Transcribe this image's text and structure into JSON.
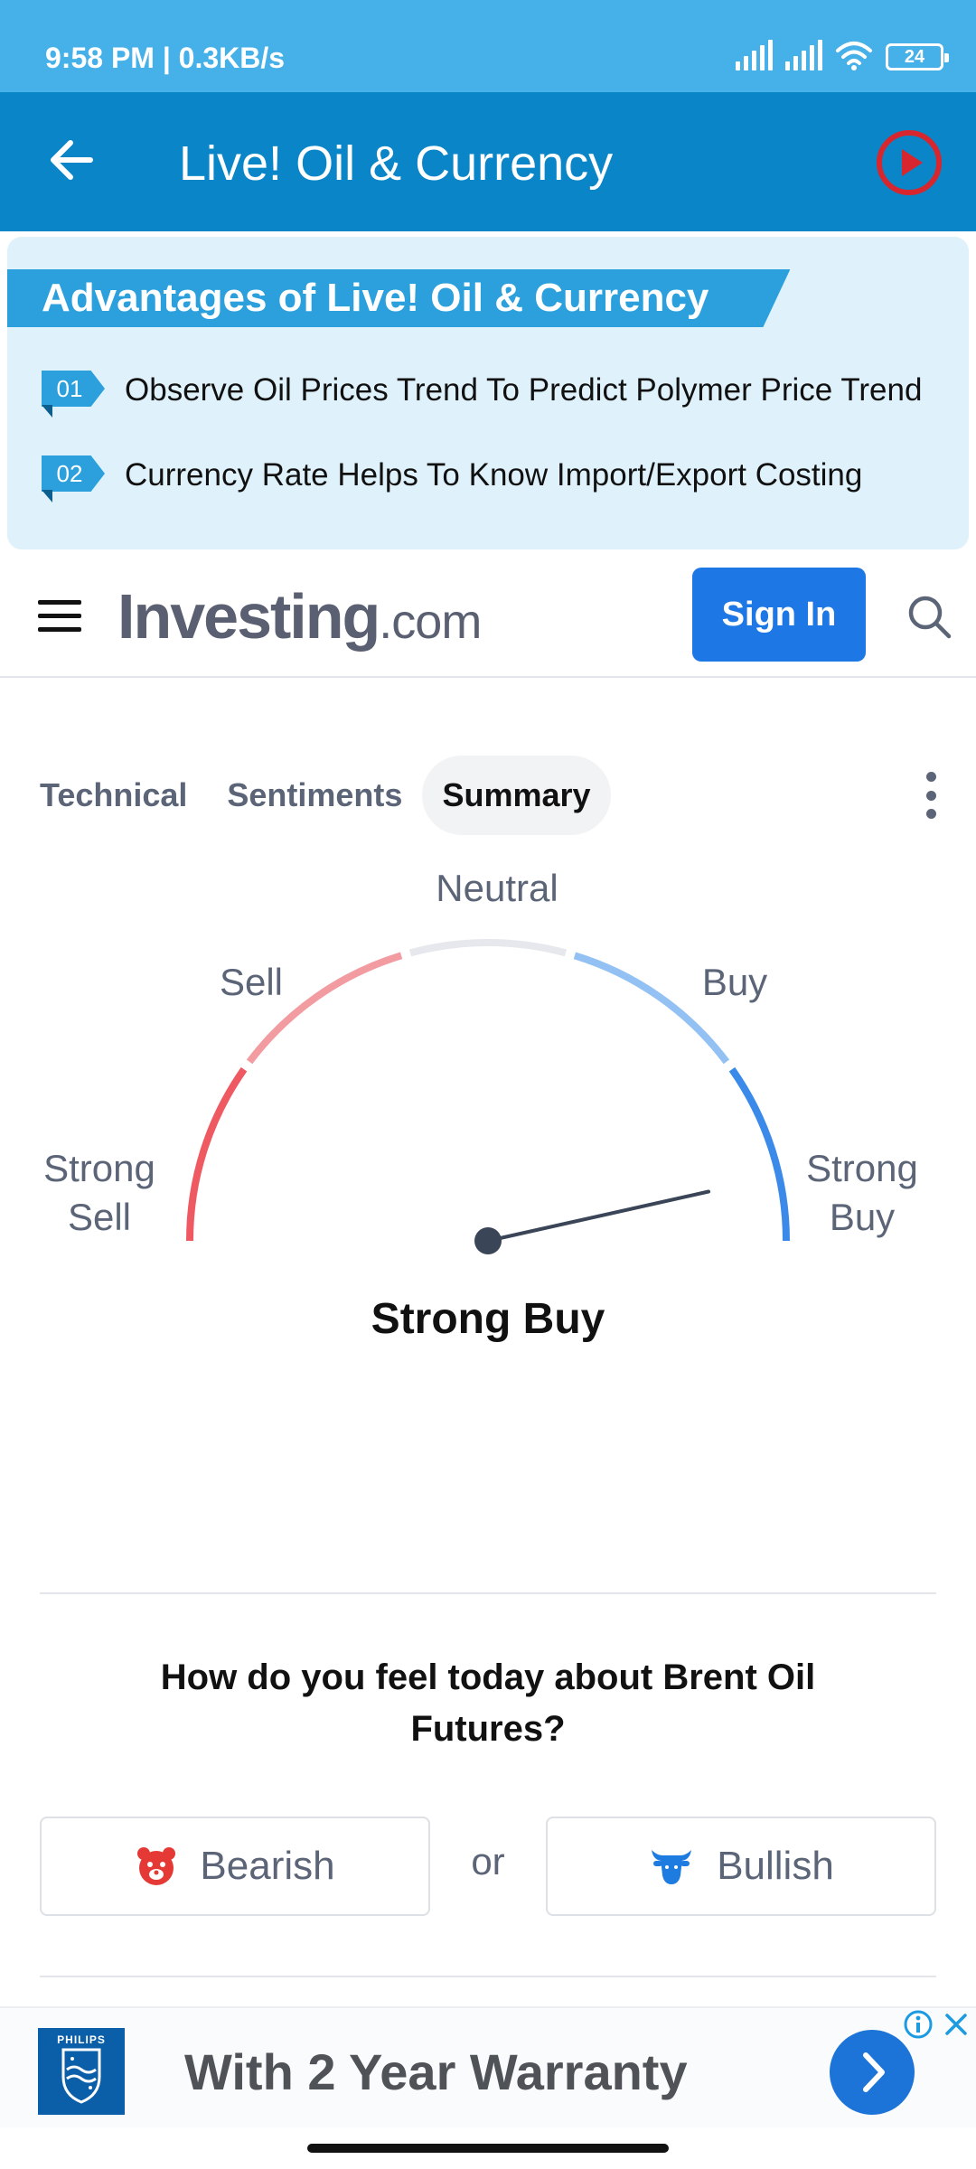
{
  "status_bar": {
    "time": "9:58 PM | 0.3KB/s",
    "battery": "24",
    "icons": [
      "signal-icon",
      "signal-icon",
      "wifi-icon",
      "battery-icon"
    ]
  },
  "app_bar": {
    "title": "Live! Oil & Currency",
    "back_icon": "arrow-left-icon",
    "play_icon": "play-circle-icon",
    "play_color": "#d7262e",
    "color": "#0a86c8"
  },
  "banner": {
    "title": "Advantages of Live! Oil & Currency",
    "items": [
      {
        "num": "01",
        "text": "Observe Oil Prices Trend To Predict Polymer Price Trend"
      },
      {
        "num": "02",
        "text": "Currency Rate Helps To Know Import/Export Costing"
      }
    ],
    "accent": "#2ba0dc"
  },
  "site_header": {
    "menu_icon": "hamburger-menu-icon",
    "logo_main": "Investing",
    "logo_suffix": ".com",
    "signin_label": "Sign In",
    "search_icon": "search-icon",
    "brand_color": "#1d78e5"
  },
  "tabs": {
    "items": [
      {
        "label": "Technical"
      },
      {
        "label": "Sentiments"
      },
      {
        "label": "Summary"
      }
    ],
    "active": "Summary",
    "more_icon": "more-vertical-icon"
  },
  "gauge": {
    "labels": {
      "strong_sell_1": "Strong",
      "strong_sell_2": "Sell",
      "sell": "Sell",
      "neutral": "Neutral",
      "buy": "Buy",
      "strong_buy_1": "Strong",
      "strong_buy_2": "Buy"
    },
    "result": "Strong Buy",
    "needle_value_fraction": 0.93,
    "segment_colors": [
      "#ef5a62",
      "#f29ca1",
      "#e6e8ed",
      "#93c1f3",
      "#3b8ae9"
    ]
  },
  "sentiment": {
    "question": "How do you feel today about Brent Oil Futures?",
    "bearish": "Bearish",
    "or": "or",
    "bullish": "Bullish",
    "bearish_icon": "bear-icon",
    "bullish_icon": "bull-icon",
    "bearish_color": "#e53935",
    "bullish_color": "#1e7be0"
  },
  "ad": {
    "brand": "PHILIPS",
    "text": "With 2 Year Warranty",
    "go_icon": "chevron-right-icon",
    "info_icon": "info-icon",
    "close_icon": "close-icon"
  }
}
